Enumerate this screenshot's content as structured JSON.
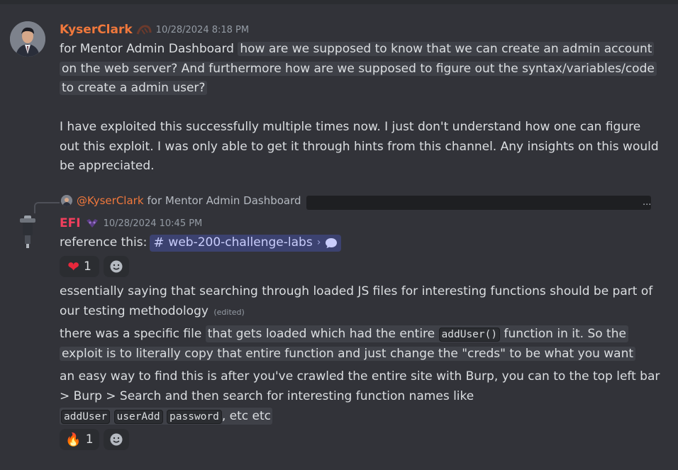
{
  "messages": {
    "kyser": {
      "username": "KyserClark",
      "timestamp": "10/28/2024 8:18 PM",
      "line1a": "for Mentor Admin Dashboard ",
      "line1b": "how are we supposed to know that we can create an admin account",
      "line2": "on the web server? And furthermore how are we supposed to figure out the syntax/variables/code",
      "line3": " to create a admin user?",
      "para2_line1": "I have exploited this successfully multiple times now. I just don't understand how one can figure",
      "para2_line2": "out this exploit. I was only able to get it through hints from this channel. Any insights on this would",
      "para2_line3": "be appreciated."
    },
    "efi": {
      "reply_mention": "@KyserClark",
      "reply_preview": "for Mentor Admin Dashboard",
      "reply_dots": "...",
      "username": "EFI",
      "timestamp": "10/28/2024 10:45 PM",
      "ref_prefix": "reference this:",
      "channel_hash": "#",
      "channel_name": "web-200-challenge-labs",
      "channel_chevron": "›",
      "reaction1": {
        "emoji": "❤",
        "count": "1"
      },
      "msg2_line1": "essentially saying that searching through loaded JS files for interesting functions should be part of",
      "msg2_line2": "our testing methodology",
      "edited_label": "(edited)",
      "msg3_line1a": "there was a specific file ",
      "msg3_line1b": "that gets loaded which had the entire ",
      "msg3_code": "addUser()",
      "msg3_line1c": " function in it. So the",
      "msg3_line2": "exploit is to literally copy that entire function and just change the \"creds\" to be what you want",
      "msg4_line1": "an easy way to find this is after you've crawled the entire site with Burp, you can to the top left bar",
      "msg4_line2": "> Burp > Search and then search for interesting function names like",
      "msg4_code1": "addUser",
      "msg4_code2": "userAdd",
      "msg4_code3": "password",
      "msg4_tail": ", etc etc",
      "reaction2": {
        "emoji": "🔥",
        "count": "1"
      }
    }
  },
  "colors": {
    "background": "#323339",
    "kyser_name": "#f0783c",
    "efi_name": "#f23f5d",
    "mention": "#c9cdfb"
  }
}
